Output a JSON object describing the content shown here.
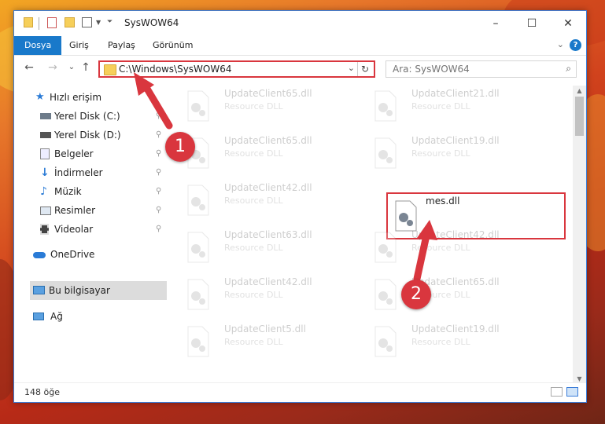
{
  "window": {
    "title": "SysWOW64",
    "minimize": "–",
    "maximize": "☐",
    "close": "✕"
  },
  "ribbon": {
    "tabs": [
      "Dosya",
      "Giriş",
      "Paylaş",
      "Görünüm"
    ],
    "expand": "⌄",
    "help": "?"
  },
  "nav": {
    "back": "←",
    "forward": "→",
    "recent": "⌄",
    "up": "↑",
    "address": "C:\\Windows\\SysWOW64",
    "address_dropdown": "⌄",
    "refresh": "↻",
    "search_placeholder": "Ara: SysWOW64",
    "search_icon": "search-icon"
  },
  "sidebar": {
    "items": [
      {
        "label": "Hızlı erişim",
        "icon": "star-icon",
        "pinned": false
      },
      {
        "label": "Yerel Disk (C:)",
        "icon": "drive-icon",
        "pinned": true
      },
      {
        "label": "Yerel Disk (D:)",
        "icon": "drive-icon",
        "pinned": true
      },
      {
        "label": "Belgeler",
        "icon": "documents-icon",
        "pinned": true
      },
      {
        "label": "İndirmeler",
        "icon": "download-icon",
        "pinned": true
      },
      {
        "label": "Müzik",
        "icon": "music-icon",
        "pinned": true
      },
      {
        "label": "Resimler",
        "icon": "pictures-icon",
        "pinned": true
      },
      {
        "label": "Videolar",
        "icon": "video-icon",
        "pinned": true
      },
      {
        "label": "OneDrive",
        "icon": "cloud-icon",
        "pinned": false
      },
      {
        "label": "Bu bilgisayar",
        "icon": "computer-icon",
        "pinned": false
      },
      {
        "label": "Ağ",
        "icon": "network-icon",
        "pinned": false
      }
    ],
    "pin_glyph": "📌"
  },
  "files": [
    {
      "name": "UpdateClient65.dll",
      "desc": "Resource DLL"
    },
    {
      "name": "UpdateClient21.dll",
      "desc": "Resource DLL"
    },
    {
      "name": "UpdateClient65.dll",
      "desc": "Resource DLL"
    },
    {
      "name": "UpdateClient19.dll",
      "desc": "Resource DLL"
    },
    {
      "name": "UpdateClient42.dll",
      "desc": "Resource DLL"
    },
    {
      "name": "mes.dll",
      "desc": ""
    },
    {
      "name": "UpdateClient63.dll",
      "desc": "Resource DLL"
    },
    {
      "name": "UpdateClient42.dll",
      "desc": "Resource DLL"
    },
    {
      "name": "UpdateClient42.dll",
      "desc": "Resource DLL"
    },
    {
      "name": "UpdateClient65.dll",
      "desc": "Resource DLL"
    },
    {
      "name": "UpdateClient5.dll",
      "desc": "Resource DLL"
    },
    {
      "name": "UpdateClient19.dll",
      "desc": "Resource DLL"
    }
  ],
  "status": {
    "count": "148 öğe"
  },
  "annotations": {
    "step1": "1",
    "step2": "2"
  },
  "colors": {
    "accent": "#1979ca",
    "highlight": "#d9363e"
  }
}
